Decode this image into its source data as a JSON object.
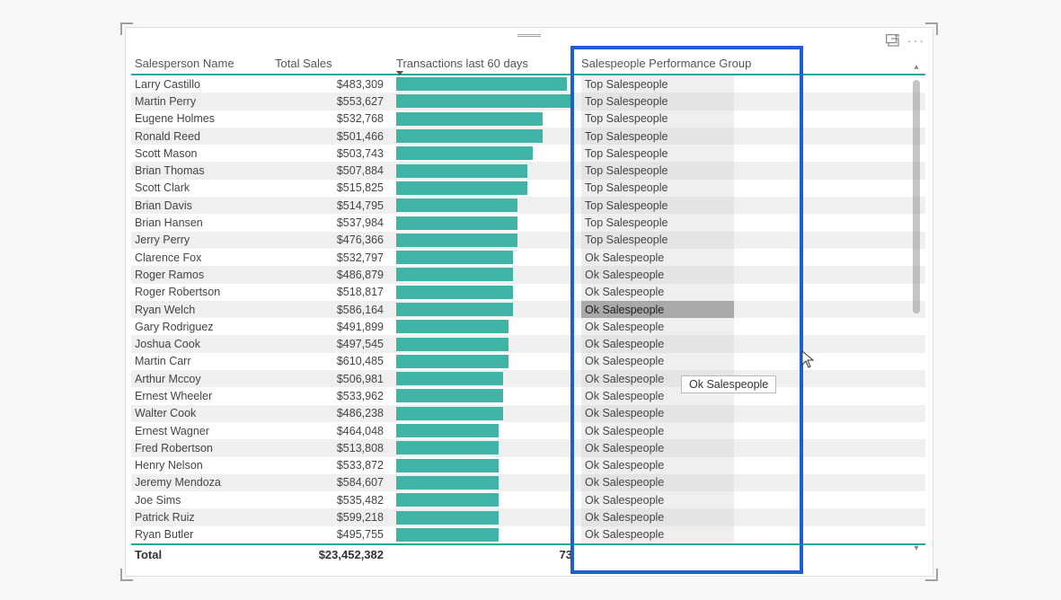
{
  "headers": {
    "name": "Salesperson Name",
    "sales": "Total Sales",
    "trans": "Transactions last 60 days",
    "group": "Salespeople Performance Group"
  },
  "total": {
    "label": "Total",
    "value": "$23,452,382",
    "trans": "73"
  },
  "tooltip": "Ok Salespeople",
  "max_trans": 36,
  "rows": [
    {
      "name": "Larry Castillo",
      "sales": "$483,309",
      "trans": 35,
      "group": "Top Salespeople"
    },
    {
      "name": "Martin Perry",
      "sales": "$553,627",
      "trans": 36,
      "group": "Top Salespeople"
    },
    {
      "name": "Eugene Holmes",
      "sales": "$532,768",
      "trans": 30,
      "group": "Top Salespeople"
    },
    {
      "name": "Ronald Reed",
      "sales": "$501,466",
      "trans": 30,
      "group": "Top Salespeople"
    },
    {
      "name": "Scott Mason",
      "sales": "$503,743",
      "trans": 28,
      "group": "Top Salespeople"
    },
    {
      "name": "Brian Thomas",
      "sales": "$507,884",
      "trans": 27,
      "group": "Top Salespeople"
    },
    {
      "name": "Scott Clark",
      "sales": "$515,825",
      "trans": 27,
      "group": "Top Salespeople"
    },
    {
      "name": "Brian Davis",
      "sales": "$514,795",
      "trans": 25,
      "group": "Top Salespeople"
    },
    {
      "name": "Brian Hansen",
      "sales": "$537,984",
      "trans": 25,
      "group": "Top Salespeople"
    },
    {
      "name": "Jerry Perry",
      "sales": "$476,366",
      "trans": 25,
      "group": "Top Salespeople"
    },
    {
      "name": "Clarence Fox",
      "sales": "$532,797",
      "trans": 24,
      "group": "Ok Salespeople"
    },
    {
      "name": "Roger Ramos",
      "sales": "$486,879",
      "trans": 24,
      "group": "Ok Salespeople"
    },
    {
      "name": "Roger Robertson",
      "sales": "$518,817",
      "trans": 24,
      "group": "Ok Salespeople"
    },
    {
      "name": "Ryan Welch",
      "sales": "$586,164",
      "trans": 24,
      "group": "Ok Salespeople",
      "highlight": true
    },
    {
      "name": "Gary Rodriguez",
      "sales": "$491,899",
      "trans": 23,
      "group": "Ok Salespeople"
    },
    {
      "name": "Joshua Cook",
      "sales": "$497,545",
      "trans": 23,
      "group": "Ok Salespeople"
    },
    {
      "name": "Martin Carr",
      "sales": "$610,485",
      "trans": 23,
      "group": "Ok Salespeople"
    },
    {
      "name": "Arthur Mccoy",
      "sales": "$506,981",
      "trans": 22,
      "group": "Ok Salespeople"
    },
    {
      "name": "Ernest Wheeler",
      "sales": "$533,962",
      "trans": 22,
      "group": "Ok Salespeople"
    },
    {
      "name": "Walter Cook",
      "sales": "$486,238",
      "trans": 22,
      "group": "Ok Salespeople"
    },
    {
      "name": "Ernest Wagner",
      "sales": "$464,048",
      "trans": 21,
      "group": "Ok Salespeople"
    },
    {
      "name": "Fred Robertson",
      "sales": "$513,808",
      "trans": 21,
      "group": "Ok Salespeople"
    },
    {
      "name": "Henry Nelson",
      "sales": "$533,872",
      "trans": 21,
      "group": "Ok Salespeople"
    },
    {
      "name": "Jeremy Mendoza",
      "sales": "$584,607",
      "trans": 21,
      "group": "Ok Salespeople"
    },
    {
      "name": "Joe Sims",
      "sales": "$535,482",
      "trans": 21,
      "group": "Ok Salespeople"
    },
    {
      "name": "Patrick Ruiz",
      "sales": "$599,218",
      "trans": 21,
      "group": "Ok Salespeople"
    },
    {
      "name": "Ryan Butler",
      "sales": "$495,755",
      "trans": 21,
      "group": "Ok Salespeople"
    }
  ]
}
